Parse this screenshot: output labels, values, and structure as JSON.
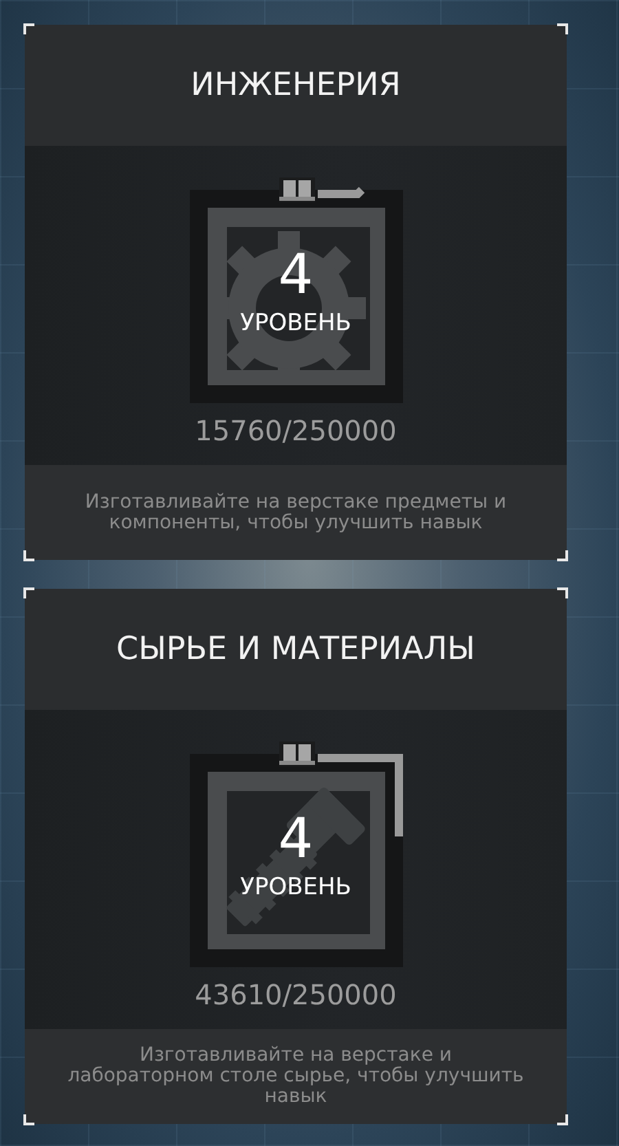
{
  "skills": [
    {
      "title": "ИНЖЕНЕРИЯ",
      "kind": "gear",
      "level_number": "4",
      "level_label": "УРОВЕНЬ",
      "progress": "15760/250000",
      "description": "Изготавливайте на верстаке предметы и компоненты, чтобы улучшить навык"
    },
    {
      "title": "СЫРЬЕ И МАТЕРИАЛЫ",
      "kind": "wrench",
      "level_number": "4",
      "level_label": "УРОВЕНЬ",
      "progress": "43610/250000",
      "description": "Изготавливайте на верстаке и лабораторном столе сырье, чтобы улучшить навык"
    }
  ]
}
